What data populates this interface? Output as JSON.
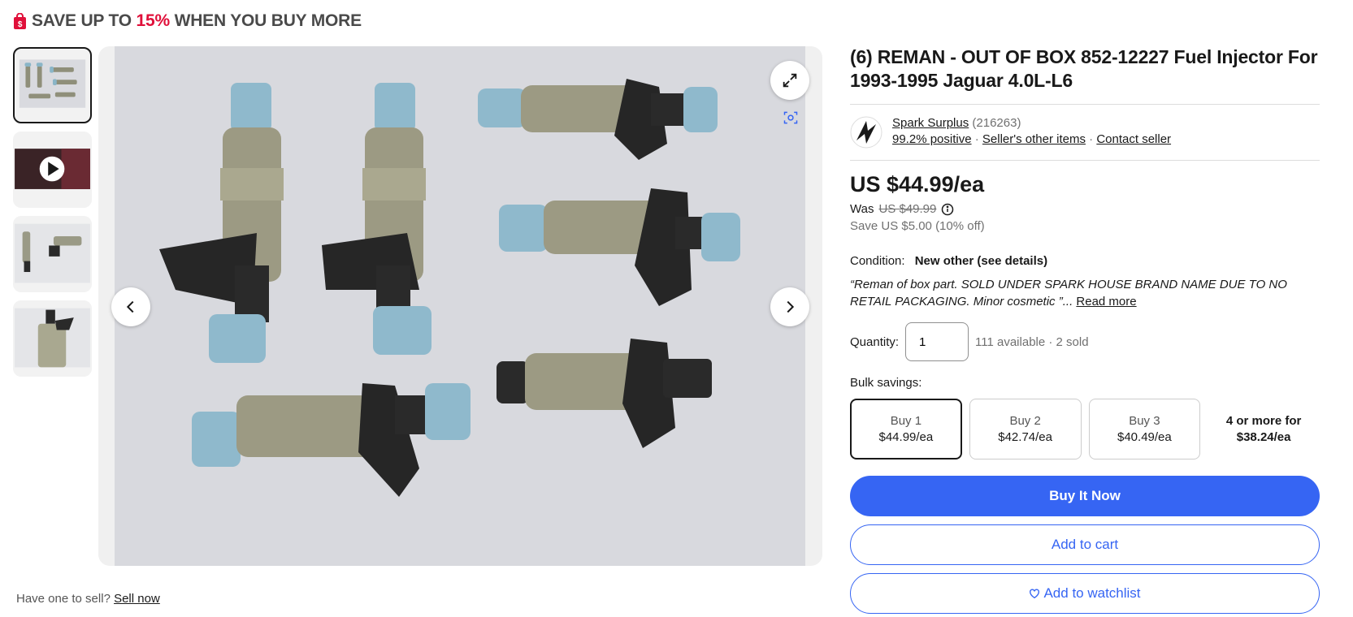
{
  "promo": {
    "prefix": "SAVE UP TO ",
    "percent": "15%",
    "suffix": " WHEN YOU BUY MORE"
  },
  "gallery": {
    "thumbnails": [
      "photo-all-injectors",
      "video",
      "photo-two-injectors",
      "photo-single-injector"
    ],
    "active_index": 0
  },
  "sell": {
    "prompt": "Have one to sell?",
    "link": "Sell now"
  },
  "item": {
    "title": "(6) REMAN - OUT OF BOX 852-12227 Fuel Injector For 1993-1995 Jaguar 4.0L-L6"
  },
  "seller": {
    "name": "Spark Surplus",
    "feedback_count": "(216263)",
    "positive": "99.2% positive",
    "sep1": " · ",
    "other_items": "Seller's other items",
    "sep2": " · ",
    "contact": "Contact seller"
  },
  "pricing": {
    "price": "US $44.99/ea",
    "was_label": "Was",
    "was_price": "US $49.99",
    "save": "Save US $5.00 (10% off)"
  },
  "condition": {
    "label": "Condition:",
    "value": "New other (see details)",
    "quote": "“Reman of box part. SOLD UNDER SPARK HOUSE BRAND NAME DUE TO NO RETAIL PACKAGING. Minor cosmetic ”",
    "ellipsis": "... ",
    "read_more": "Read more"
  },
  "quantity": {
    "label": "Quantity:",
    "value": "1",
    "availability": "111 available · 2 sold"
  },
  "bulk": {
    "label": "Bulk savings:",
    "options": [
      {
        "qty": "Buy 1",
        "price": "$44.99/ea"
      },
      {
        "qty": "Buy 2",
        "price": "$42.74/ea"
      },
      {
        "qty": "Buy 3",
        "price": "$40.49/ea"
      }
    ],
    "more": {
      "qty": "4 or more for",
      "price": "$38.24/ea"
    },
    "selected_index": 0
  },
  "actions": {
    "buy_now": "Buy It Now",
    "add_to_cart": "Add to cart",
    "watchlist": "Add to watchlist"
  },
  "colors": {
    "accent_blue": "#3665f3",
    "promo_red": "#e0103a"
  }
}
